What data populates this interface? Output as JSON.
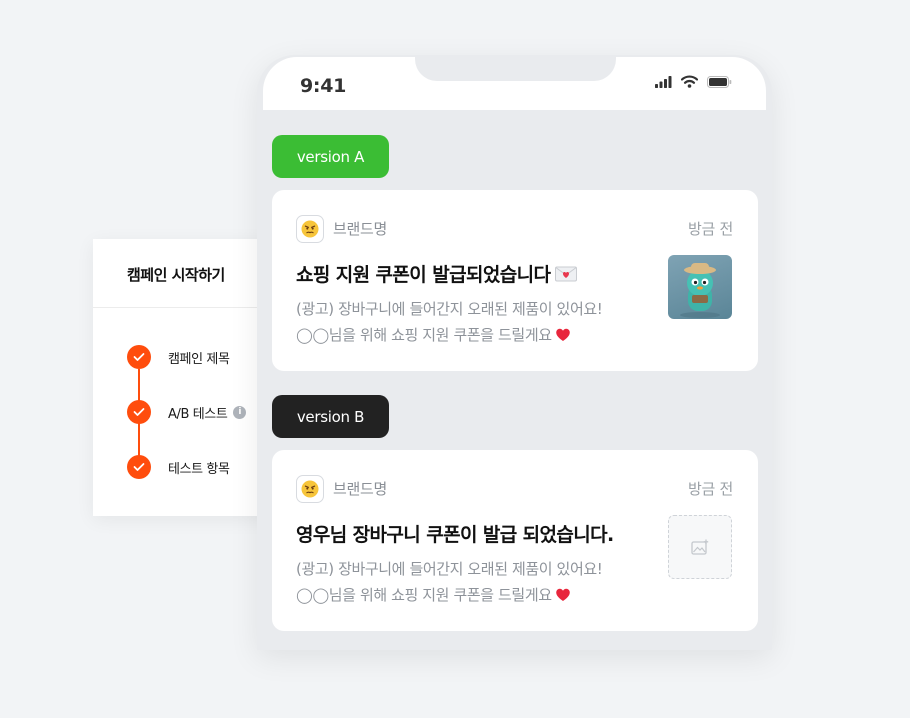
{
  "panel": {
    "title": "캠페인 시작하기",
    "steps": [
      {
        "label": "캠페인 제목"
      },
      {
        "label": "A/B 테스트",
        "info_icon": "info-icon"
      },
      {
        "label": "테스트 항목"
      }
    ],
    "check_icon": "check-icon",
    "accent_color": "#ff4d0d"
  },
  "phone": {
    "status_bar": {
      "time": "9:41",
      "icons": [
        "signal-icon",
        "wifi-icon",
        "battery-icon"
      ]
    },
    "versions": [
      {
        "badge": "version A",
        "badge_color": "#3bbd34",
        "notification": {
          "brand_icon": "angry-face-icon",
          "brand_name": "브랜드명",
          "time_ago": "방금 전",
          "title": "쇼핑 지원 쿠폰이 발급되었습니다",
          "title_emoji": "love-letter-icon",
          "line1": "(광고) 장바구니에 들어간지 오래된 제품이 있어요!",
          "line2": "◯◯님을 위해 쇼핑 지원 쿠폰을 드릴게요",
          "line2_emoji": "heart-icon",
          "thumbnail": "mascot-figure-image"
        }
      },
      {
        "badge": "version B",
        "badge_color": "#222222",
        "notification": {
          "brand_icon": "angry-face-icon",
          "brand_name": "브랜드명",
          "time_ago": "방금 전",
          "title": "영우님 장바구니 쿠폰이 발급 되었습니다.",
          "line1": "(광고) 장바구니에 들어간지 오래된 제품이 있어요!",
          "line2": "◯◯님을 위해 쇼핑 지원 쿠폰을 드릴게요",
          "line2_emoji": "heart-icon",
          "thumbnail": "image-placeholder-icon"
        }
      }
    ]
  }
}
